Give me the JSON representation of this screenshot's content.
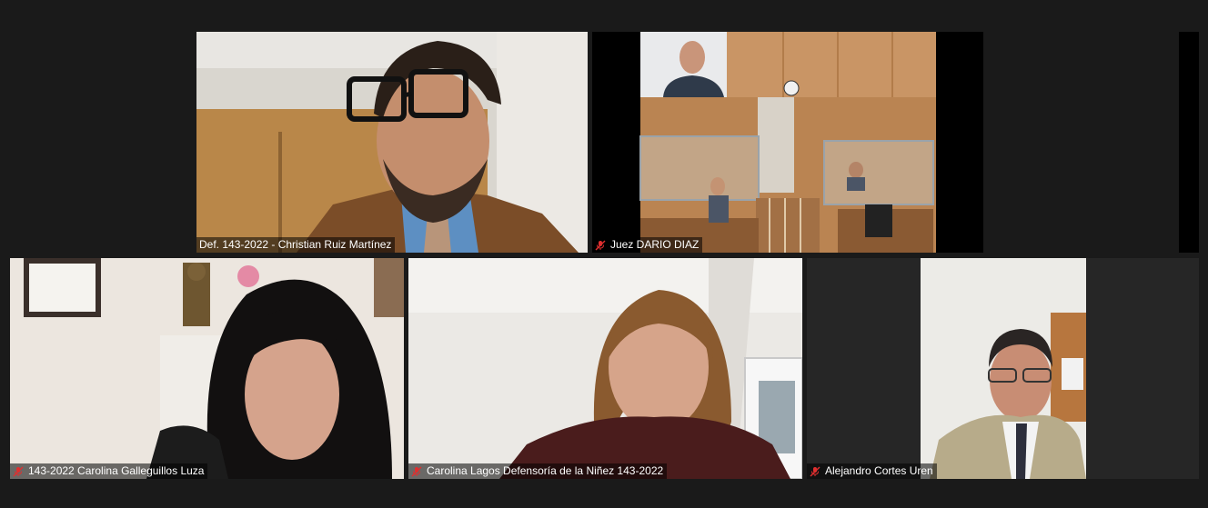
{
  "participants": [
    {
      "id": "p1",
      "name": "Def. 143-2022 - Christian Ruiz Martínez",
      "muted": false
    },
    {
      "id": "p2",
      "name": "Juez DARIO DIAZ",
      "muted": true
    },
    {
      "id": "p3",
      "name": "143-2022 Carolina Galleguillos Luza",
      "muted": true
    },
    {
      "id": "p4",
      "name": "Carolina Lagos Defensoría de la Niñez 143-2022",
      "muted": true
    },
    {
      "id": "p5",
      "name": "Alejandro Cortes Uren",
      "muted": true
    }
  ],
  "icons": {
    "muted": "mic-muted-icon"
  },
  "colors": {
    "background": "#1a1a1a",
    "label_bg": "rgba(0,0,0,0.55)",
    "muted_icon": "#e02f2f"
  }
}
